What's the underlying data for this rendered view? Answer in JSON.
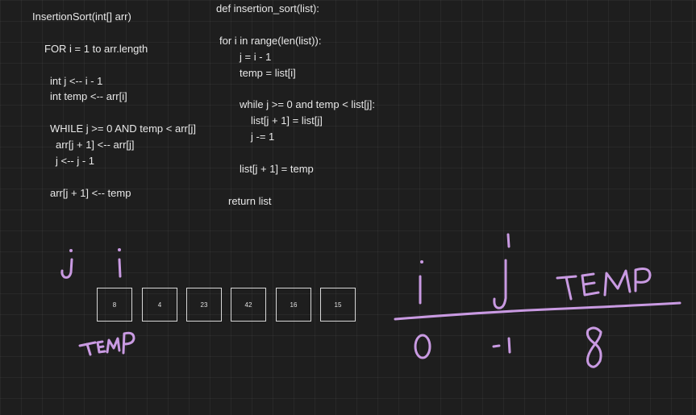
{
  "pseudocode": [
    "InsertionSort(int[] arr)",
    "FOR i = 1 to arr.length",
    "int j <-- i - 1",
    "int temp <-- arr[i]",
    "WHILE j >= 0 AND temp < arr[j]",
    "arr[j + 1] <-- arr[j]",
    "j <-- j - 1",
    "arr[j + 1] <-- temp"
  ],
  "python": [
    "def insertion_sort(list):",
    "for i in range(len(list)):",
    "j = i - 1",
    "temp = list[i]",
    "while j >= 0 and temp < list[j]:",
    "list[j + 1] = list[j]",
    "j -= 1",
    "list[j + 1] = temp",
    "return list"
  ],
  "array": [
    "8",
    "4",
    "23",
    "42",
    "16",
    "15"
  ],
  "handwriting": {
    "pointer_j": "j",
    "pointer_i": "i",
    "temp_label": "TEMP",
    "table_headers": [
      "i",
      "j",
      "TEMP"
    ],
    "table_values": [
      "0",
      "-1",
      "8"
    ],
    "ink_color": "#c99ae2"
  }
}
